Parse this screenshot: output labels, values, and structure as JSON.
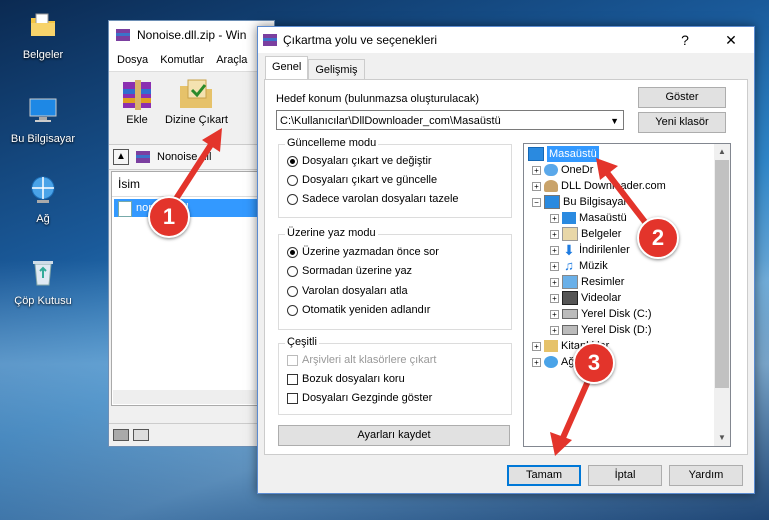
{
  "desktop": {
    "icons": [
      {
        "label": "Belgeler",
        "icon": "folder-documents-icon"
      },
      {
        "label": "Bu Bilgisayar",
        "icon": "computer-icon"
      },
      {
        "label": "Ağ",
        "icon": "network-icon"
      },
      {
        "label": "Çöp Kutusu",
        "icon": "recycle-bin-icon"
      }
    ]
  },
  "winrar": {
    "title": "Nonoise.dll.zip - Win",
    "menu": [
      "Dosya",
      "Komutlar",
      "Araçla"
    ],
    "toolbar": {
      "add": "Ekle",
      "extract": "Dizine Çıkart"
    },
    "path": "Nonoise.dll",
    "column": "İsim",
    "file": "nonoise.dll"
  },
  "dialog": {
    "title": "Çıkartma yolu ve seçenekleri",
    "help": "?",
    "close": "✕",
    "tabs": [
      "Genel",
      "Gelişmiş"
    ],
    "dest_label": "Hedef konum (bulunmazsa oluşturulacak)",
    "dest_value": "C:\\Kullanıcılar\\DllDownloader_com\\Masaüstü",
    "show_button": "Göster",
    "new_folder_button": "Yeni klasör",
    "update_group": {
      "title": "Güncelleme modu",
      "options": [
        "Dosyaları çıkart ve değiştir",
        "Dosyaları çıkart ve güncelle",
        "Sadece varolan dosyaları tazele"
      ],
      "selected": 0
    },
    "overwrite_group": {
      "title": "Üzerine yaz modu",
      "options": [
        "Üzerine yazmadan önce sor",
        "Sormadan üzerine yaz",
        "Varolan dosyaları atla",
        "Otomatik yeniden adlandır"
      ],
      "selected": 0
    },
    "misc_group": {
      "title": "Çeşitli",
      "options": [
        "Arşivleri alt klasörlere çıkart",
        "Bozuk dosyaları koru",
        "Dosyaları Gezginde göster"
      ]
    },
    "save_settings": "Ayarları kaydet",
    "tree": {
      "selected": "Masaüstü",
      "onedrive": "OneDr",
      "user": "DLL Downloader.com",
      "pc": "Bu Bilgisayar",
      "pc_children": [
        "Masaüstü",
        "Belgeler",
        "İndirilenler",
        "Müzik",
        "Resimler",
        "Videolar",
        "Yerel Disk (C:)",
        "Yerel Disk (D:)"
      ],
      "libraries": "Kitaplıklar",
      "network": "Ağ"
    },
    "ok": "Tamam",
    "cancel": "İptal",
    "help_button": "Yardım"
  },
  "annotations": [
    "1",
    "2",
    "3"
  ]
}
